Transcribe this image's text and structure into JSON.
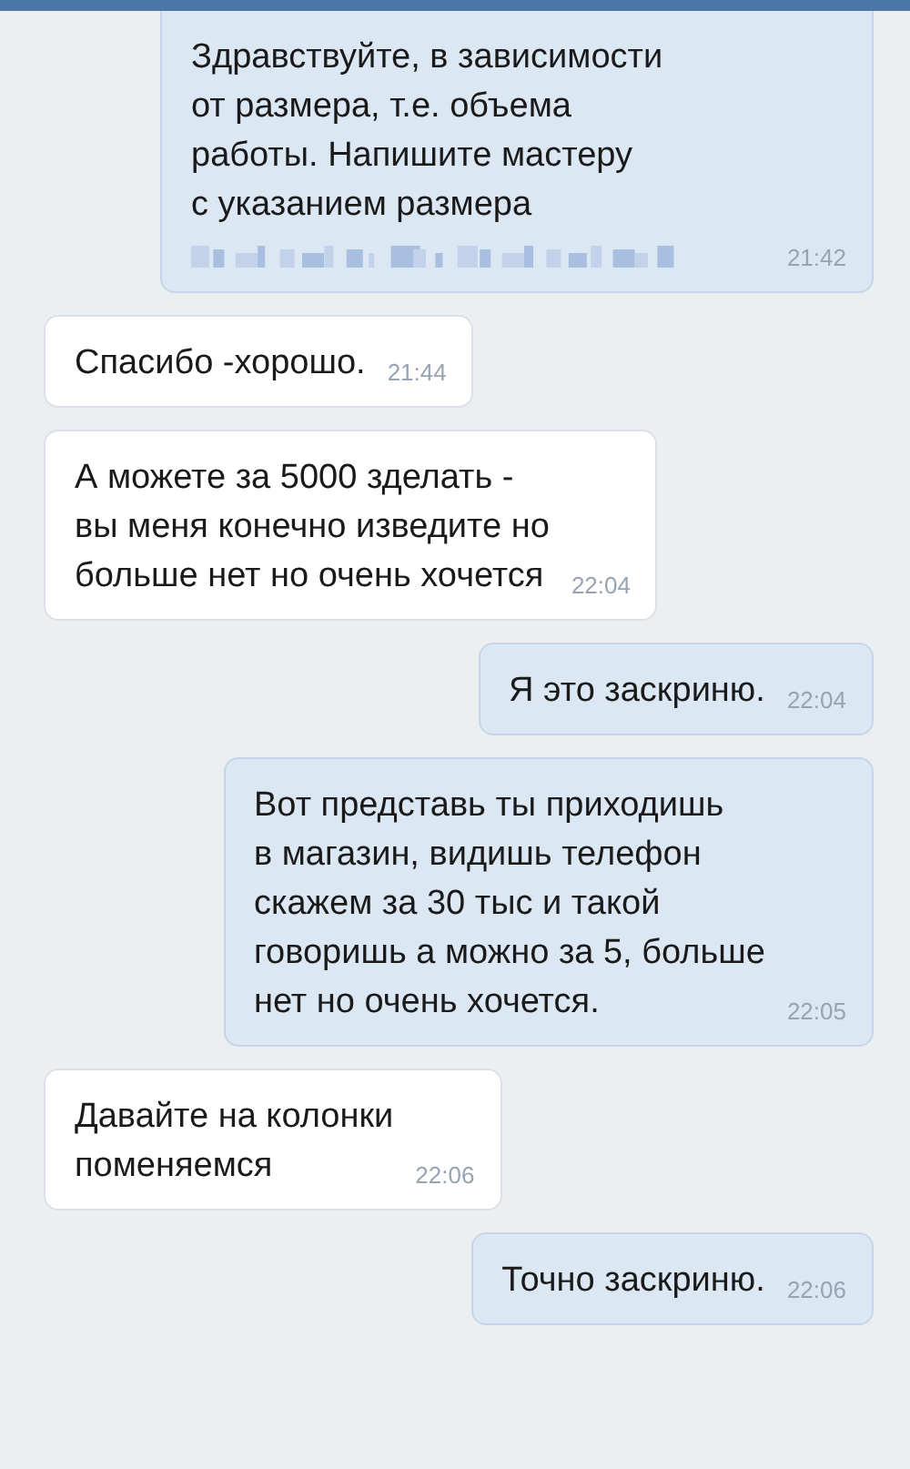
{
  "messages": [
    {
      "kind": "outgoing",
      "text": "Здравствуйте, в зависимости\nот размера, т.е. объема\nработы. Напишите мастеру\nс указанием размера",
      "redacted": true,
      "time": "21:42"
    },
    {
      "kind": "incoming",
      "text": "Спасибо -хорошо.",
      "time": "21:44"
    },
    {
      "kind": "incoming",
      "text": "А можете за 5000 зделать -\nвы меня конечно изведите но\nбольше нет но очень хочется",
      "time": "22:04"
    },
    {
      "kind": "outgoing",
      "text": "Я это заскриню.",
      "time": "22:04"
    },
    {
      "kind": "outgoing",
      "text": "Вот представь ты приходишь\nв магазин, видишь телефон\nскажем за 30 тыс и такой\nговоришь а можно за 5, больше\nнет но очень хочется.",
      "time": "22:05"
    },
    {
      "kind": "incoming",
      "text": "Давайте на колонки\nпоменяемся",
      "time": "22:06"
    },
    {
      "kind": "outgoing",
      "text": "Точно заскриню.",
      "time": "22:06"
    }
  ]
}
